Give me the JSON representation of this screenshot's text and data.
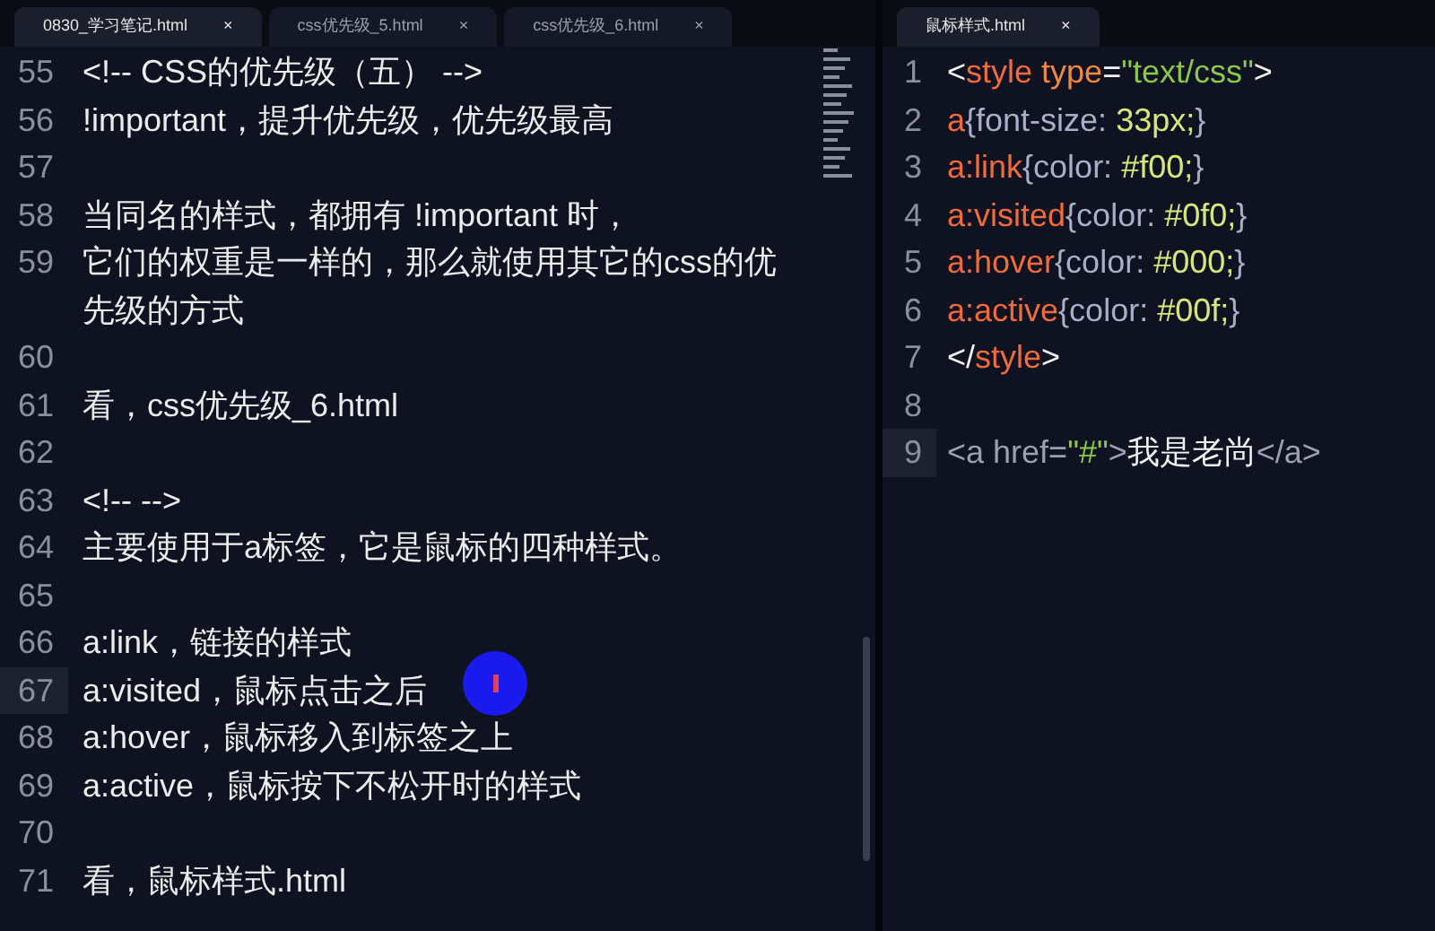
{
  "left_pane": {
    "tabs": [
      {
        "label": "0830_学习笔记.html",
        "close": "×",
        "selected": true
      },
      {
        "label": "css优先级_5.html",
        "close": "×",
        "selected": false
      },
      {
        "label": "css优先级_6.html",
        "close": "×",
        "selected": false
      }
    ],
    "lines": [
      {
        "number": "55",
        "text": "<!-- CSS的优先级（五） -->",
        "current": false
      },
      {
        "number": "56",
        "text": "!important，提升优先级，优先级最高",
        "current": false
      },
      {
        "number": "57",
        "current": false
      },
      {
        "number": "58",
        "text": "当同名的样式，都拥有 !important 时，",
        "current": false
      },
      {
        "number": "59",
        "text": "它们的权重是一样的，那么就使用其它的css的优先级的方式",
        "current": false
      },
      {
        "number": "60",
        "current": false
      },
      {
        "number": "61",
        "text": "看，css优先级_6.html",
        "current": false
      },
      {
        "number": "62",
        "current": false
      },
      {
        "number": "63",
        "text": "<!--  -->",
        "current": false
      },
      {
        "number": "64",
        "text": "主要使用于a标签，它是鼠标的四种样式。",
        "current": false
      },
      {
        "number": "65",
        "current": false
      },
      {
        "number": "66",
        "text": "a:link，链接的样式",
        "current": false
      },
      {
        "number": "67",
        "text": "a:visited，鼠标点击之后",
        "current": true
      },
      {
        "number": "68",
        "text": "a:hover，鼠标移入到标签之上",
        "current": false
      },
      {
        "number": "69",
        "text": "a:active，鼠标按下不松开时的样式",
        "current": false
      },
      {
        "number": "70",
        "current": false
      },
      {
        "number": "71",
        "text": "看，鼠标样式.html",
        "current": false
      }
    ]
  },
  "right_pane": {
    "tabs": [
      {
        "label": "鼠标样式.html",
        "close": "×",
        "selected": true
      }
    ],
    "lines": [
      {
        "number": "1",
        "current": false,
        "tokens": [
          {
            "kind": "punct",
            "text": "<"
          },
          {
            "kind": "tag",
            "text": "style"
          },
          {
            "kind": "attr",
            "text": " type"
          },
          {
            "kind": "punct",
            "text": "="
          },
          {
            "kind": "string",
            "text": "\"text/css\""
          },
          {
            "kind": "punct",
            "text": ">"
          }
        ]
      },
      {
        "number": "2",
        "current": false,
        "tokens": [
          {
            "kind": "tag",
            "text": "a"
          },
          {
            "kind": "prop",
            "text": "{font-size: "
          },
          {
            "kind": "value",
            "text": "33px;"
          },
          {
            "kind": "prop",
            "text": "}"
          }
        ]
      },
      {
        "number": "3",
        "current": false,
        "tokens": [
          {
            "kind": "tag",
            "text": "a:link"
          },
          {
            "kind": "prop",
            "text": "{color: "
          },
          {
            "kind": "value",
            "text": "#f00;"
          },
          {
            "kind": "prop",
            "text": "}"
          }
        ]
      },
      {
        "number": "4",
        "current": false,
        "tokens": [
          {
            "kind": "tag",
            "text": "a:visited"
          },
          {
            "kind": "prop",
            "text": "{color: "
          },
          {
            "kind": "value",
            "text": "#0f0;"
          },
          {
            "kind": "prop",
            "text": "}"
          }
        ]
      },
      {
        "number": "5",
        "current": false,
        "tokens": [
          {
            "kind": "tag",
            "text": "a:hover"
          },
          {
            "kind": "prop",
            "text": "{color: "
          },
          {
            "kind": "value",
            "text": "#000;"
          },
          {
            "kind": "prop",
            "text": "}"
          }
        ]
      },
      {
        "number": "6",
        "current": false,
        "tokens": [
          {
            "kind": "tag",
            "text": "a:active"
          },
          {
            "kind": "prop",
            "text": "{color: "
          },
          {
            "kind": "value",
            "text": "#00f;"
          },
          {
            "kind": "prop",
            "text": "}"
          }
        ]
      },
      {
        "number": "7",
        "current": false,
        "tokens": [
          {
            "kind": "punct",
            "text": "</"
          },
          {
            "kind": "tag",
            "text": "style"
          },
          {
            "kind": "punct",
            "text": ">"
          }
        ]
      },
      {
        "number": "8",
        "current": false
      },
      {
        "number": "9",
        "current": true,
        "tokens": [
          {
            "kind": "dim",
            "text": "<a href="
          },
          {
            "kind": "string",
            "text": "\"#\""
          },
          {
            "kind": "dim",
            "text": ">"
          },
          {
            "kind": "punct",
            "text": "我是老尚"
          },
          {
            "kind": "dim",
            "text": "</a>"
          }
        ]
      }
    ]
  }
}
